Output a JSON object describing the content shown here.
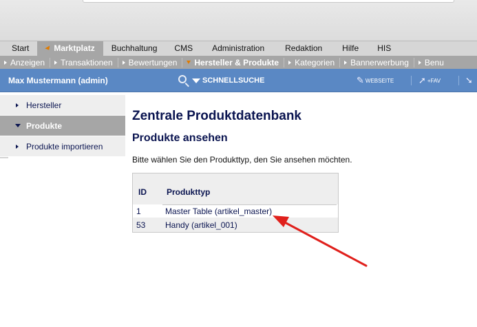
{
  "tabs": [
    {
      "label": "Start",
      "active": false
    },
    {
      "label": "Marktplatz",
      "active": true
    },
    {
      "label": "Buchhaltung",
      "active": false
    },
    {
      "label": "CMS",
      "active": false
    },
    {
      "label": "Administration",
      "active": false
    },
    {
      "label": "Redaktion",
      "active": false
    },
    {
      "label": "Hilfe",
      "active": false
    },
    {
      "label": "HIS",
      "active": false
    }
  ],
  "subnav": [
    {
      "label": "Anzeigen"
    },
    {
      "label": "Transaktionen"
    },
    {
      "label": "Bewertungen"
    },
    {
      "label": "Hersteller & Produkte",
      "active": true
    },
    {
      "label": "Kategorien"
    },
    {
      "label": "Bannerwerbung"
    },
    {
      "label": "Benu"
    }
  ],
  "userbar": {
    "username": "Max Mustermann (admin)",
    "quicksearch": "SCHNELLSUCHE",
    "website": "WEBSEITE",
    "fav": "+FAV"
  },
  "sidebar": {
    "items": [
      {
        "label": "Hersteller",
        "active": false
      },
      {
        "label": "Produkte",
        "active": true
      },
      {
        "label": "Produkte importieren",
        "active": false
      }
    ]
  },
  "main": {
    "title": "Zentrale Produktdatenbank",
    "subtitle": "Produkte ansehen",
    "intro": "Bitte wählen Sie den Produkttyp, den Sie ansehen möchten.",
    "table": {
      "headers": [
        "ID",
        "Produkttyp"
      ],
      "rows": [
        {
          "id": "1",
          "type": "Master Table (artikel_master)"
        },
        {
          "id": "53",
          "type": "Handy (artikel_001)"
        }
      ]
    }
  },
  "colors": {
    "userbar": "#5a88c4",
    "tab_active": "#a6a6a6",
    "heading": "#0a1450",
    "annotation_arrow": "#e0201c"
  }
}
